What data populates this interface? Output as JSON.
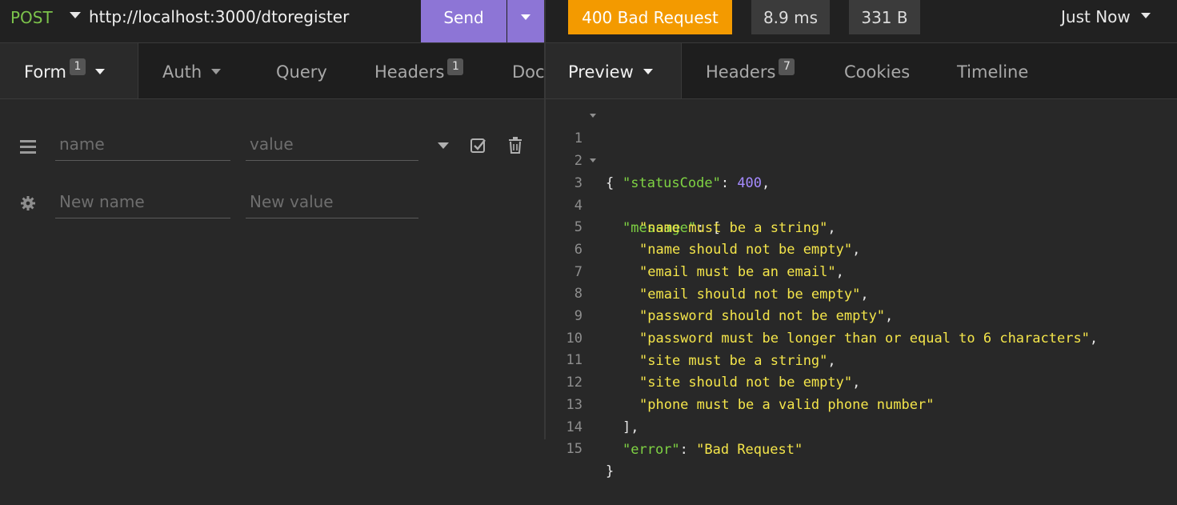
{
  "request": {
    "method": "POST",
    "url": "http://localhost:3000/dtoregister",
    "send_label": "Send"
  },
  "response_meta": {
    "status": "400 Bad Request",
    "time": "8.9 ms",
    "size": "331 B",
    "history": "Just Now"
  },
  "request_tabs": [
    {
      "label": "Form",
      "badge": "1"
    },
    {
      "label": "Auth"
    },
    {
      "label": "Query"
    },
    {
      "label": "Headers",
      "badge": "1"
    },
    {
      "label": "Doc"
    }
  ],
  "form": {
    "row1": {
      "name_placeholder": "name",
      "value_placeholder": "value"
    },
    "row2": {
      "name_placeholder": "New name",
      "value_placeholder": "New value"
    }
  },
  "response_tabs": [
    {
      "label": "Preview"
    },
    {
      "label": "Headers",
      "badge": "7"
    },
    {
      "label": "Cookies"
    },
    {
      "label": "Timeline"
    }
  ],
  "response_body": {
    "line_numbers": [
      "1",
      "2",
      "3",
      "4",
      "5",
      "6",
      "7",
      "8",
      "9",
      "10",
      "11",
      "12",
      "13",
      "14",
      "15"
    ],
    "statusCode_key": "\"statusCode\"",
    "statusCode_value": "400",
    "message_key": "\"message\"",
    "messages": [
      "\"name must be a string\"",
      "\"name should not be empty\"",
      "\"email must be an email\"",
      "\"email should not be empty\"",
      "\"password should not be empty\"",
      "\"password must be longer than or equal to 6 characters\"",
      "\"site must be a string\"",
      "\"site should not be empty\"",
      "\"phone must be a valid phone number\""
    ],
    "error_key": "\"error\"",
    "error_value": "\"Bad Request\""
  }
}
